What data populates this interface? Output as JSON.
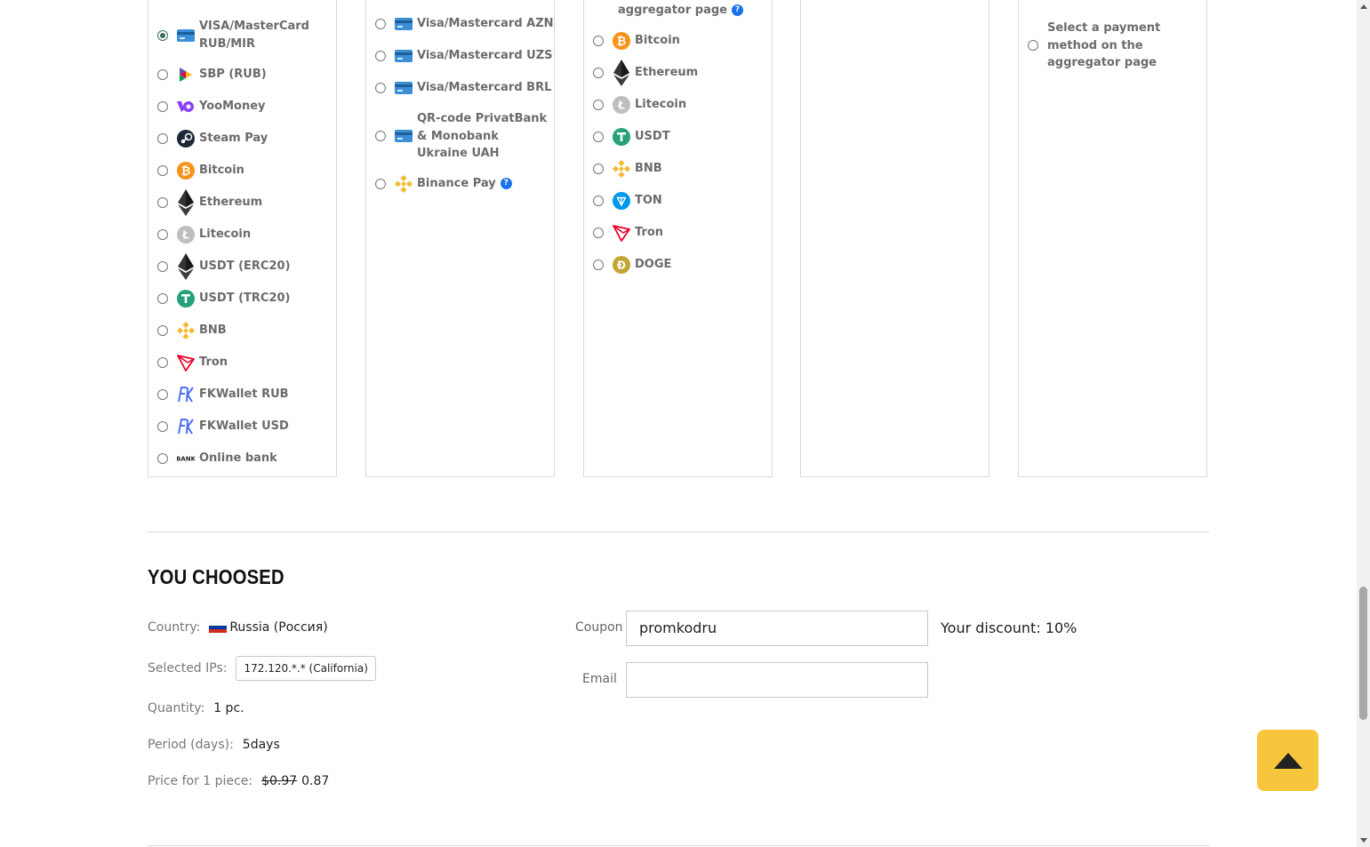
{
  "col1": [
    {
      "label": "VISA/MasterCard RUB/MIR",
      "icon": "card-icon",
      "checked": true
    },
    {
      "label": "SBP (RUB)",
      "icon": "sbp-icon"
    },
    {
      "label": "YooMoney",
      "icon": "yoomoney-icon"
    },
    {
      "label": "Steam Pay",
      "icon": "steam-icon"
    },
    {
      "label": "Bitcoin",
      "icon": "bitcoin-icon"
    },
    {
      "label": "Ethereum",
      "icon": "ethereum-icon"
    },
    {
      "label": "Litecoin",
      "icon": "litecoin-icon"
    },
    {
      "label": "USDT (ERC20)",
      "icon": "ethereum-icon"
    },
    {
      "label": "USDT (TRC20)",
      "icon": "tether-icon"
    },
    {
      "label": "BNB",
      "icon": "bnb-icon"
    },
    {
      "label": "Tron",
      "icon": "tron-icon"
    },
    {
      "label": "FKWallet RUB",
      "icon": "fkwallet-icon"
    },
    {
      "label": "FKWallet USD",
      "icon": "fkwallet-icon"
    },
    {
      "label": "Online bank",
      "icon": "bank-icon"
    }
  ],
  "col2": [
    {
      "label": "Visa/Mastercard AZN",
      "icon": "card-icon"
    },
    {
      "label": "Visa/Mastercard UZS",
      "icon": "card-icon"
    },
    {
      "label": "Visa/Mastercard BRL",
      "icon": "card-icon"
    },
    {
      "label": "QR-code PrivatBank & Monobank Ukraine UAH",
      "icon": "card-icon"
    },
    {
      "label": "Binance Pay",
      "icon": "binance-icon",
      "help": "?"
    }
  ],
  "col3_header": {
    "label": "aggregator page",
    "help": "?"
  },
  "col3": [
    {
      "label": "Bitcoin",
      "icon": "bitcoin-icon"
    },
    {
      "label": "Ethereum",
      "icon": "ethereum-icon"
    },
    {
      "label": "Litecoin",
      "icon": "litecoin-icon"
    },
    {
      "label": "USDT",
      "icon": "tether-icon"
    },
    {
      "label": "BNB",
      "icon": "bnb-icon"
    },
    {
      "label": "TON",
      "icon": "ton-icon"
    },
    {
      "label": "Tron",
      "icon": "tron-icon"
    },
    {
      "label": "DOGE",
      "icon": "doge-icon"
    }
  ],
  "col5": {
    "label": "Select a payment method on the aggregator page"
  },
  "summary": {
    "title": "YOU CHOOSED",
    "country_label": "Country:",
    "country_value": "Russia (Россия)",
    "ips_label": "Selected IPs:",
    "ips_value": "172.120.*.* (California)",
    "quantity_label": "Quantity:",
    "quantity_value": "1 pc.",
    "period_label": "Period (days):",
    "period_value": "5days",
    "price_label": "Price for 1 piece:",
    "price_old": "$0.97",
    "price_new": "0.87"
  },
  "form": {
    "coupon_label": "Coupon",
    "coupon_value": "promkodru",
    "email_label": "Email",
    "email_value": "",
    "discount": "Your discount: 10%"
  },
  "colors": {
    "accent": "#f8c63c",
    "help": "#1a73e8"
  }
}
